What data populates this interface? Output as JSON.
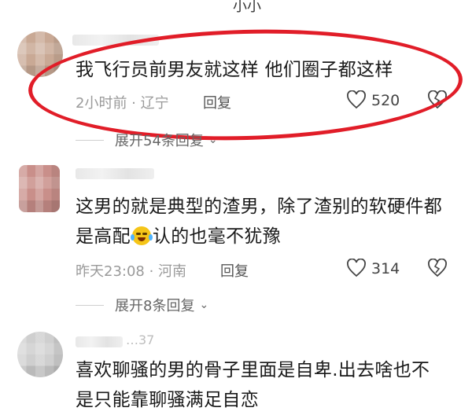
{
  "top_fragment": "小小",
  "comments": [
    {
      "text": "我飞行员前男友就这样 他们圈子都这样",
      "time": "2小时前",
      "location": "辽宁",
      "reply_label": "回复",
      "likes": "520",
      "expand_label": "展开54条回复"
    },
    {
      "text_line1": "这男的就是典型的渣男，除了渣别的软硬件都",
      "text_line2a": "是高配",
      "text_line2b": "认的也毫不犹豫",
      "time": "昨天23:08",
      "location": "河南",
      "reply_label": "回复",
      "likes": "314",
      "expand_label": "展开8条回复"
    },
    {
      "username_fragment": "…37",
      "text_line1": "喜欢聊骚的男的骨子里面是自卑.出去啥也不",
      "text_line2": "是只能靠聊骚满足自恋"
    }
  ],
  "separator": " · ",
  "colors": {
    "highlight_oval": "#e11d28"
  },
  "icons": [
    "heart-icon",
    "broken-heart-icon",
    "chevron-down-icon",
    "laughing-crying-emoji"
  ]
}
